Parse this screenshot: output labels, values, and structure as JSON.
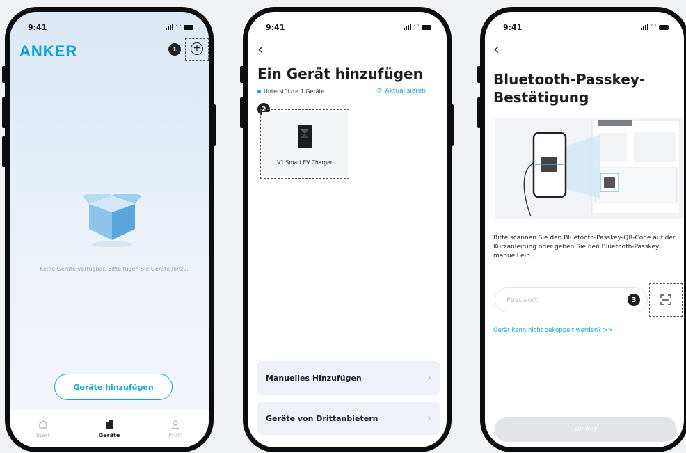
{
  "status": {
    "time": "9:41"
  },
  "screen1": {
    "logo": "ANKER",
    "add_icon": "plus-circle-icon",
    "marker": "1",
    "empty_text": "Keine Geräte verfügbar. Bitte fügen Sie Geräte hinzu.",
    "add_button": "Geräte hinzufügen",
    "tabs": [
      {
        "label": "Start",
        "icon": "home-icon"
      },
      {
        "label": "Geräte",
        "icon": "devices-icon"
      },
      {
        "label": "Profil",
        "icon": "profile-icon"
      }
    ]
  },
  "screen2": {
    "title": "Ein Gerät hinzufügen",
    "supported": "Unterstützte 1 Geräte ...",
    "refresh": "Aktualisieren",
    "marker": "2",
    "device_name": "V1 Smart EV Charger",
    "rows": [
      {
        "label": "Manuelles Hinzufügen"
      },
      {
        "label": "Geräte von Drittanbietern"
      }
    ]
  },
  "screen3": {
    "title_line1": "Bluetooth-Passkey-",
    "title_line2": "Bestätigung",
    "instruction": "Bitte scannen Sie den Bluetooth-Passkey-QR-Code auf der Kurzanleitung oder geben Sie den Bluetooth-Passkey manuell ein.",
    "password_placeholder": "Passwort",
    "marker": "3",
    "link": "Gerät kann nicht gekoppelt werden? >>",
    "next_button": "Weiter"
  },
  "colors": {
    "accent": "#15a7c9",
    "logo": "#00a0d8",
    "frame": "#0d0d0f"
  }
}
